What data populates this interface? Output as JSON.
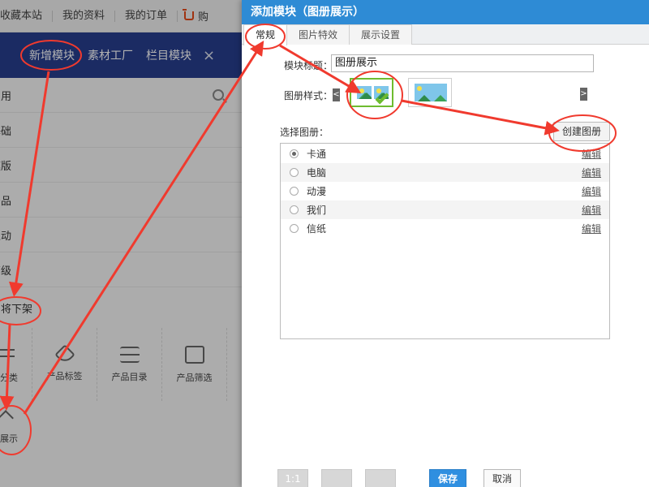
{
  "topbar": {
    "links": [
      "收藏本站",
      "我的资料",
      "我的订单"
    ],
    "cart_label": "购"
  },
  "navbar": {
    "items": [
      "新增模块",
      "素材工厂",
      "栏目模块"
    ],
    "close_glyph": "×"
  },
  "sidebar": {
    "rows": [
      "常用",
      "基础",
      "模版",
      "产品",
      "互动",
      "高级"
    ],
    "special_label": "即将下架",
    "tiles": [
      "分类",
      "产品标签",
      "产品目录",
      "产品筛选"
    ],
    "last_tile": "展示"
  },
  "dialog": {
    "title": "添加模块（图册展示）",
    "tabs": [
      "常规",
      "图片特效",
      "展示设置"
    ],
    "module_title_label": "模块标题：",
    "module_title_value": "图册展示",
    "style_label": "图册样式：",
    "prev_glyph": "<",
    "next_glyph": ">",
    "album_select_label": "选择图册：",
    "create_album_button": "创建图册",
    "albums": [
      {
        "name": "卡通",
        "edit": "编辑",
        "selected": true
      },
      {
        "name": "电脑",
        "edit": "编辑",
        "selected": false
      },
      {
        "name": "动漫",
        "edit": "编辑",
        "selected": false
      },
      {
        "name": "我们",
        "edit": "编辑",
        "selected": false
      },
      {
        "name": "信纸",
        "edit": "编辑",
        "selected": false
      }
    ],
    "footer": {
      "ratio_label": "1:1",
      "save": "保存",
      "cancel": "取消"
    }
  },
  "colors": {
    "annotation": "#f03a2e",
    "dialog_header": "#2e8bd5",
    "nav_bg": "#283e8f",
    "selected_style": "#6ebc2f"
  }
}
